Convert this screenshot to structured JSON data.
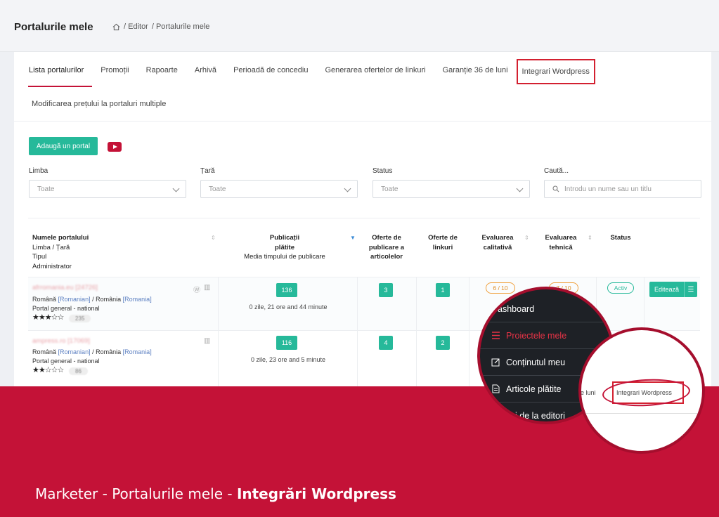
{
  "header": {
    "title": "Portalurile mele",
    "breadcrumb": [
      "/ Editor",
      "/ Portalurile mele"
    ]
  },
  "tabs": [
    {
      "label": "Lista portalurilor"
    },
    {
      "label": "Promoții"
    },
    {
      "label": "Rapoarte"
    },
    {
      "label": "Arhivă"
    },
    {
      "label": "Perioadă de concediu"
    },
    {
      "label": "Generarea ofertelor de linkuri"
    },
    {
      "label": "Garanție 36 de luni"
    },
    {
      "label": "Integrari Wordpress"
    }
  ],
  "tab_row2": "Modificarea prețului la portaluri multiple",
  "actions": {
    "add_portal": "Adaugă un portal"
  },
  "filters": {
    "language": {
      "label": "Limba",
      "value": "Toate"
    },
    "country": {
      "label": "Țară",
      "value": "Toate"
    },
    "status": {
      "label": "Status",
      "value": "Toate"
    },
    "search": {
      "label": "Caută...",
      "placeholder": "Introdu un nume sau un titlu"
    }
  },
  "table": {
    "headers": {
      "name": [
        "Numele portalului",
        "Limba / Țară",
        "Tipul",
        "Administrator"
      ],
      "published": [
        "Publicații",
        "plătite",
        "Media timpului de publicare"
      ],
      "offers_articles": [
        "Oferte de",
        "publicare a",
        "articolelor"
      ],
      "offers_links": [
        "Oferte de",
        "linkuri"
      ],
      "quality": [
        "Evaluarea",
        "calitativă"
      ],
      "technical": [
        "Evaluarea",
        "tehnică"
      ],
      "status": "Status"
    },
    "rows": [
      {
        "name": "afrromania.eu [24726]",
        "lang_a": "Română",
        "lang_a_link": "[Romanian]",
        "sep": "/",
        "country": "România",
        "country_link": "[Romania]",
        "type": "Portal general - national",
        "stars": "★★★☆☆",
        "count": "235",
        "published": "136",
        "avg_time": "0 zile, 21 ore and 44 minute",
        "offers_articles": "3",
        "offers_links": "1",
        "quality": "6 / 10",
        "technical": "7 / 10",
        "status": "Activ",
        "edit": "Editează"
      },
      {
        "name": "ampress.ro [17069]",
        "lang_a": "Română",
        "lang_a_link": "[Romanian]",
        "sep": "/",
        "country": "România",
        "country_link": "[Romania]",
        "type": "Portal general - national",
        "stars": "★★☆☆☆",
        "count": "86",
        "published": "116",
        "avg_time": "0 zile, 23 ore and 5 minute",
        "offers_articles": "4",
        "offers_links": "2"
      }
    ]
  },
  "zoom_menu": [
    "Dashboard",
    "Proiectele mele",
    "Conținutul meu",
    "Articole plătite",
    "Linkuri de la editori"
  ],
  "zoom_tab": {
    "prev": "de luni",
    "label": "Integrari Wordpress"
  },
  "caption": {
    "prefix": "Marketer - Portalurile mele - ",
    "bold": "Integrări Wordpress"
  },
  "colors": {
    "brand": "#c41237",
    "accent": "#26b99a",
    "orange": "#f0a03c"
  }
}
